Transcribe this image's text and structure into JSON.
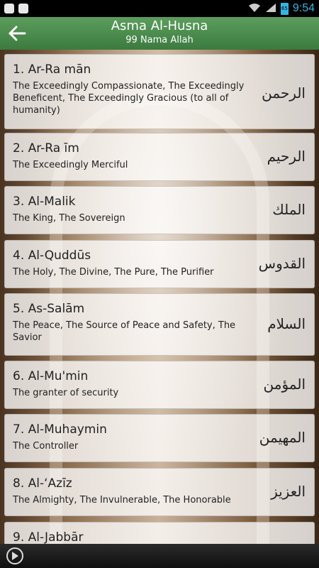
{
  "status_bar": {
    "time": "9:54",
    "battery": "65"
  },
  "header": {
    "title": "Asma Al-Husna",
    "subtitle": "99 Nama Allah"
  },
  "items": [
    {
      "name": "1. Ar-Ra mān",
      "meaning": "The Exceedingly Compassionate, The Exceedingly Beneficent, The Exceedingly Gracious (to all of humanity)",
      "arabic": "الرحمن"
    },
    {
      "name": "2. Ar-Ra īm",
      "meaning": "The Exceedingly Merciful",
      "arabic": "الرحيم"
    },
    {
      "name": "3. Al-Malik",
      "meaning": "The King, The Sovereign",
      "arabic": "الملك"
    },
    {
      "name": "4. Al-Quddūs",
      "meaning": "The Holy, The Divine, The Pure, The Purifier",
      "arabic": "القدوس"
    },
    {
      "name": "5. As-Salām",
      "meaning": "The Peace, The Source of Peace and Safety, The Savior",
      "arabic": "السلام"
    },
    {
      "name": "6. Al-Mu'min",
      "meaning": "The granter of security",
      "arabic": "المؤمن"
    },
    {
      "name": "7. Al-Muhaymin",
      "meaning": "The Controller",
      "arabic": "المهيمن"
    },
    {
      "name": "8. Al-‘Azīz",
      "meaning": "The Almighty, The Invulnerable, The Honorable",
      "arabic": "العزيز"
    },
    {
      "name": "9. Al-Jabbār",
      "meaning": "",
      "arabic": ""
    }
  ],
  "icons": {
    "back": "back-arrow-icon",
    "play": "play-icon"
  }
}
